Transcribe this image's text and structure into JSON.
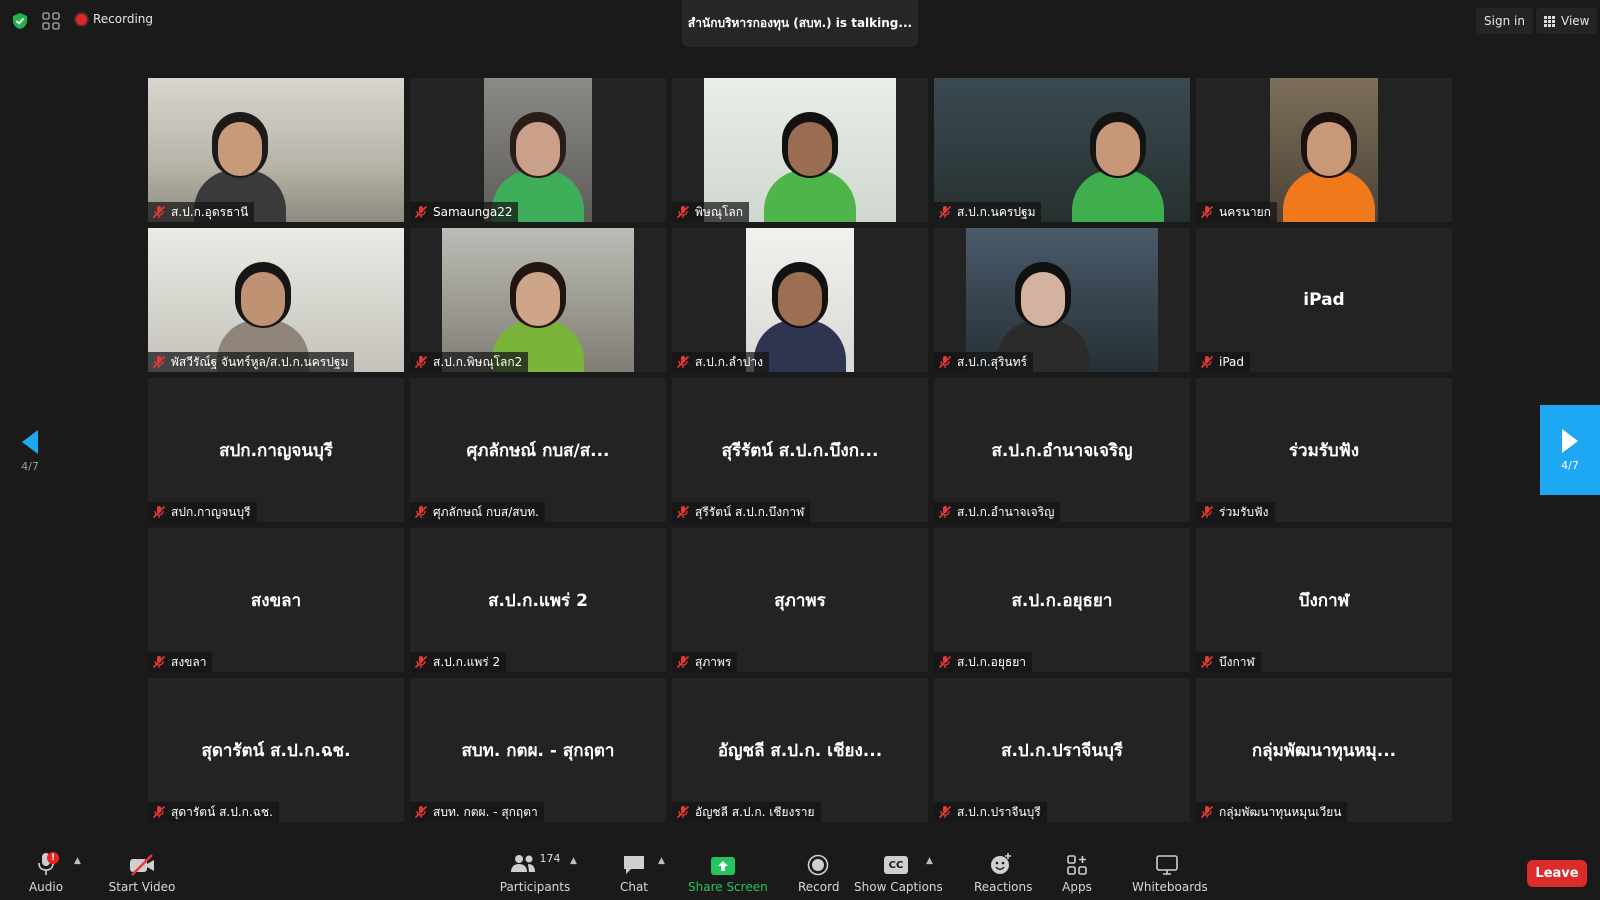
{
  "topbar": {
    "recording_label": "Recording",
    "talking_text": "สำนักบริหารกองทุน (สบท.) is  talking...",
    "signin_label": "Sign in",
    "view_label": "View"
  },
  "tiles": [
    {
      "name": "ส.ป.ก.อุดรธานี",
      "video": true
    },
    {
      "name": "Samaunga22",
      "video": true
    },
    {
      "name": "พิษณุโลก",
      "video": true
    },
    {
      "name": "ส.ป.ก.นครปฐม",
      "video": true
    },
    {
      "name": "นครนายก",
      "video": true
    },
    {
      "name": "พัสวีรัณ์ฐ จันทร์หูล/ส.ป.ก.นครปฐม",
      "video": true
    },
    {
      "name": "ส.ป.ก.พิษณุโลก2",
      "video": true
    },
    {
      "name": "ส.ป.ก.ลำปาง",
      "video": true
    },
    {
      "name": "ส.ป.ก.สุรินทร์",
      "video": true
    },
    {
      "name": "iPad",
      "center": "iPad",
      "video": false
    },
    {
      "name": "สปก.กาญจนบุรี",
      "center": "สปก.กาญจนบุรี",
      "video": false
    },
    {
      "name": "ศุภลักษณ์ กบส/สบท.",
      "center": "ศุภลักษณ์ กบส/ส...",
      "video": false
    },
    {
      "name": "สุรีรัตน์ ส.ป.ก.บึงกาฬ",
      "center": "สุรีรัตน์ ส.ป.ก.บึงก...",
      "video": false
    },
    {
      "name": "ส.ป.ก.อำนาจเจริญ",
      "center": "ส.ป.ก.อำนาจเจริญ",
      "video": false
    },
    {
      "name": "ร่วมรับฟัง",
      "center": "ร่วมรับฟัง",
      "video": false
    },
    {
      "name": "สงขลา",
      "center": "สงขลา",
      "video": false
    },
    {
      "name": "ส.ป.ก.แพร่ 2",
      "center": "ส.ป.ก.แพร่ 2",
      "video": false
    },
    {
      "name": "สุภาพร",
      "center": "สุภาพร",
      "video": false
    },
    {
      "name": "ส.ป.ก.อยุธยา",
      "center": "ส.ป.ก.อยุธยา",
      "video": false
    },
    {
      "name": "บึงกาฬ",
      "center": "บึงกาฬ",
      "video": false
    },
    {
      "name": "สุดารัตน์ ส.ป.ก.ฉช.",
      "center": "สุดารัตน์ ส.ป.ก.ฉช.",
      "video": false
    },
    {
      "name": "สบท. กตผ. - สุกฤตา",
      "center": "สบท. กตผ. - สุกฤตา",
      "video": false
    },
    {
      "name": "อัญชลี ส.ป.ก. เชียงราย",
      "center": "อัญชลี ส.ป.ก. เชียง...",
      "video": false
    },
    {
      "name": "ส.ป.ก.ปราจีนบุรี",
      "center": "ส.ป.ก.ปราจีนบุรี",
      "video": false
    },
    {
      "name": "กลุ่มพัฒนาทุนหมุนเวียน",
      "center": "กลุ่มพัฒนาทุนหมุ...",
      "video": false
    }
  ],
  "pagination": {
    "left": "4/7",
    "right": "4/7"
  },
  "toolbar": {
    "audio": "Audio",
    "audio_badge": "!",
    "start_video": "Start Video",
    "participants": "Participants",
    "participants_count": "174",
    "chat": "Chat",
    "share_screen": "Share Screen",
    "record": "Record",
    "show_captions": "Show Captions",
    "captions_icon": "CC",
    "reactions": "Reactions",
    "apps": "Apps",
    "whiteboards": "Whiteboards",
    "leave": "Leave"
  },
  "colors": {
    "accent_blue": "#1ea7f2",
    "leave_red": "#dc2b2b",
    "share_green": "#22c55e",
    "mute_red": "#e53935"
  }
}
